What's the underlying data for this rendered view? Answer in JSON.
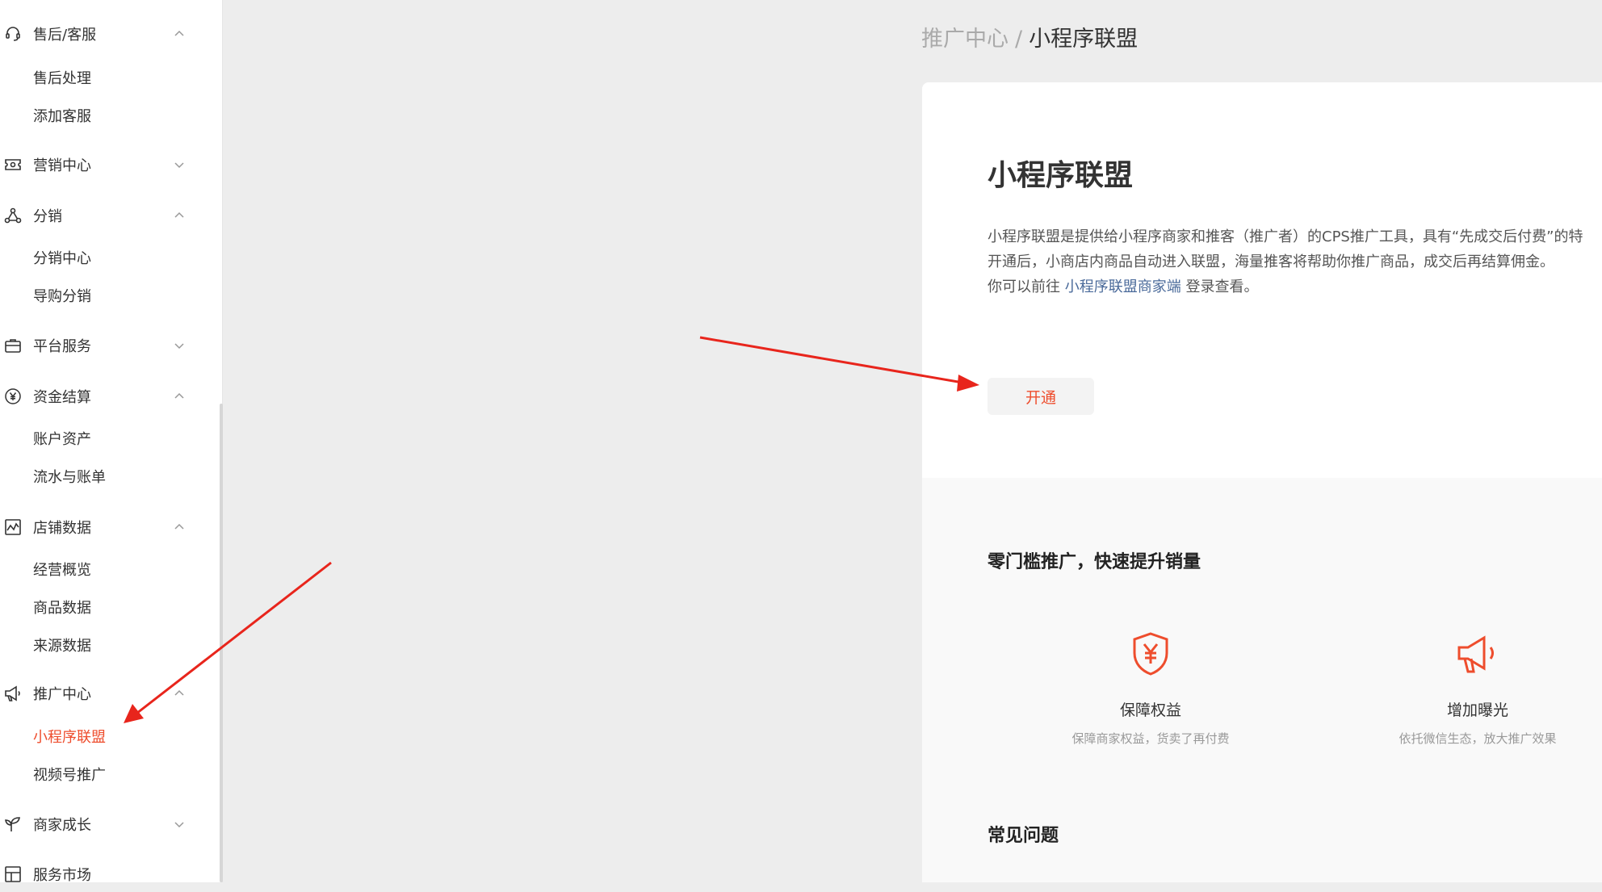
{
  "sidebar": {
    "groups": [
      {
        "label": "售后/客服",
        "icon": "headset-icon",
        "expanded": true
      },
      {
        "label": "营销中心",
        "icon": "ticket-icon",
        "expanded": false
      },
      {
        "label": "分销",
        "icon": "share-nodes-icon",
        "expanded": true
      },
      {
        "label": "平台服务",
        "icon": "briefcase-icon",
        "expanded": false
      },
      {
        "label": "资金结算",
        "icon": "yen-circle-icon",
        "expanded": true
      },
      {
        "label": "店铺数据",
        "icon": "chart-icon",
        "expanded": true
      },
      {
        "label": "推广中心",
        "icon": "megaphone-icon",
        "expanded": true
      },
      {
        "label": "商家成长",
        "icon": "sprout-icon",
        "expanded": false
      },
      {
        "label": "服务市场",
        "icon": "market-icon",
        "expanded": false
      }
    ],
    "sub": {
      "after_sales": [
        "售后处理",
        "添加客服"
      ],
      "distribution": [
        "分销中心",
        "导购分销"
      ],
      "funds": [
        "账户资产",
        "流水与账单"
      ],
      "data": [
        "经营概览",
        "商品数据",
        "来源数据"
      ],
      "promotion": [
        "小程序联盟",
        "视频号推广"
      ]
    },
    "active_item": "小程序联盟"
  },
  "breadcrumb": {
    "parent": "推广中心",
    "separator": "/",
    "current": "小程序联盟"
  },
  "main": {
    "title": "小程序联盟",
    "desc_line1": "小程序联盟是提供给小程序商家和推客（推广者）的CPS推广工具，具有“先成交后付费”的特",
    "desc_line2": "开通后，小商店内商品自动进入联盟，海量推客将帮助你推广商品，成交后再结算佣金。",
    "desc_line3_prefix": "你可以前往 ",
    "desc_link": "小程序联盟商家端",
    "desc_line3_suffix": " 登录查看。",
    "open_button": "开通",
    "section_title": "零门槛推广，快速提升销量",
    "features": [
      {
        "title": "保障权益",
        "desc": "保障商家权益，货卖了再付费",
        "icon": "shield-yen-icon"
      },
      {
        "title": "增加曝光",
        "desc": "依托微信生态，放大推广效果",
        "icon": "megaphone-icon"
      }
    ],
    "faq_title": "常见问题"
  },
  "colors": {
    "accent": "#ee4d2d",
    "link": "#4a6a9a",
    "arrow": "#e8251c"
  }
}
